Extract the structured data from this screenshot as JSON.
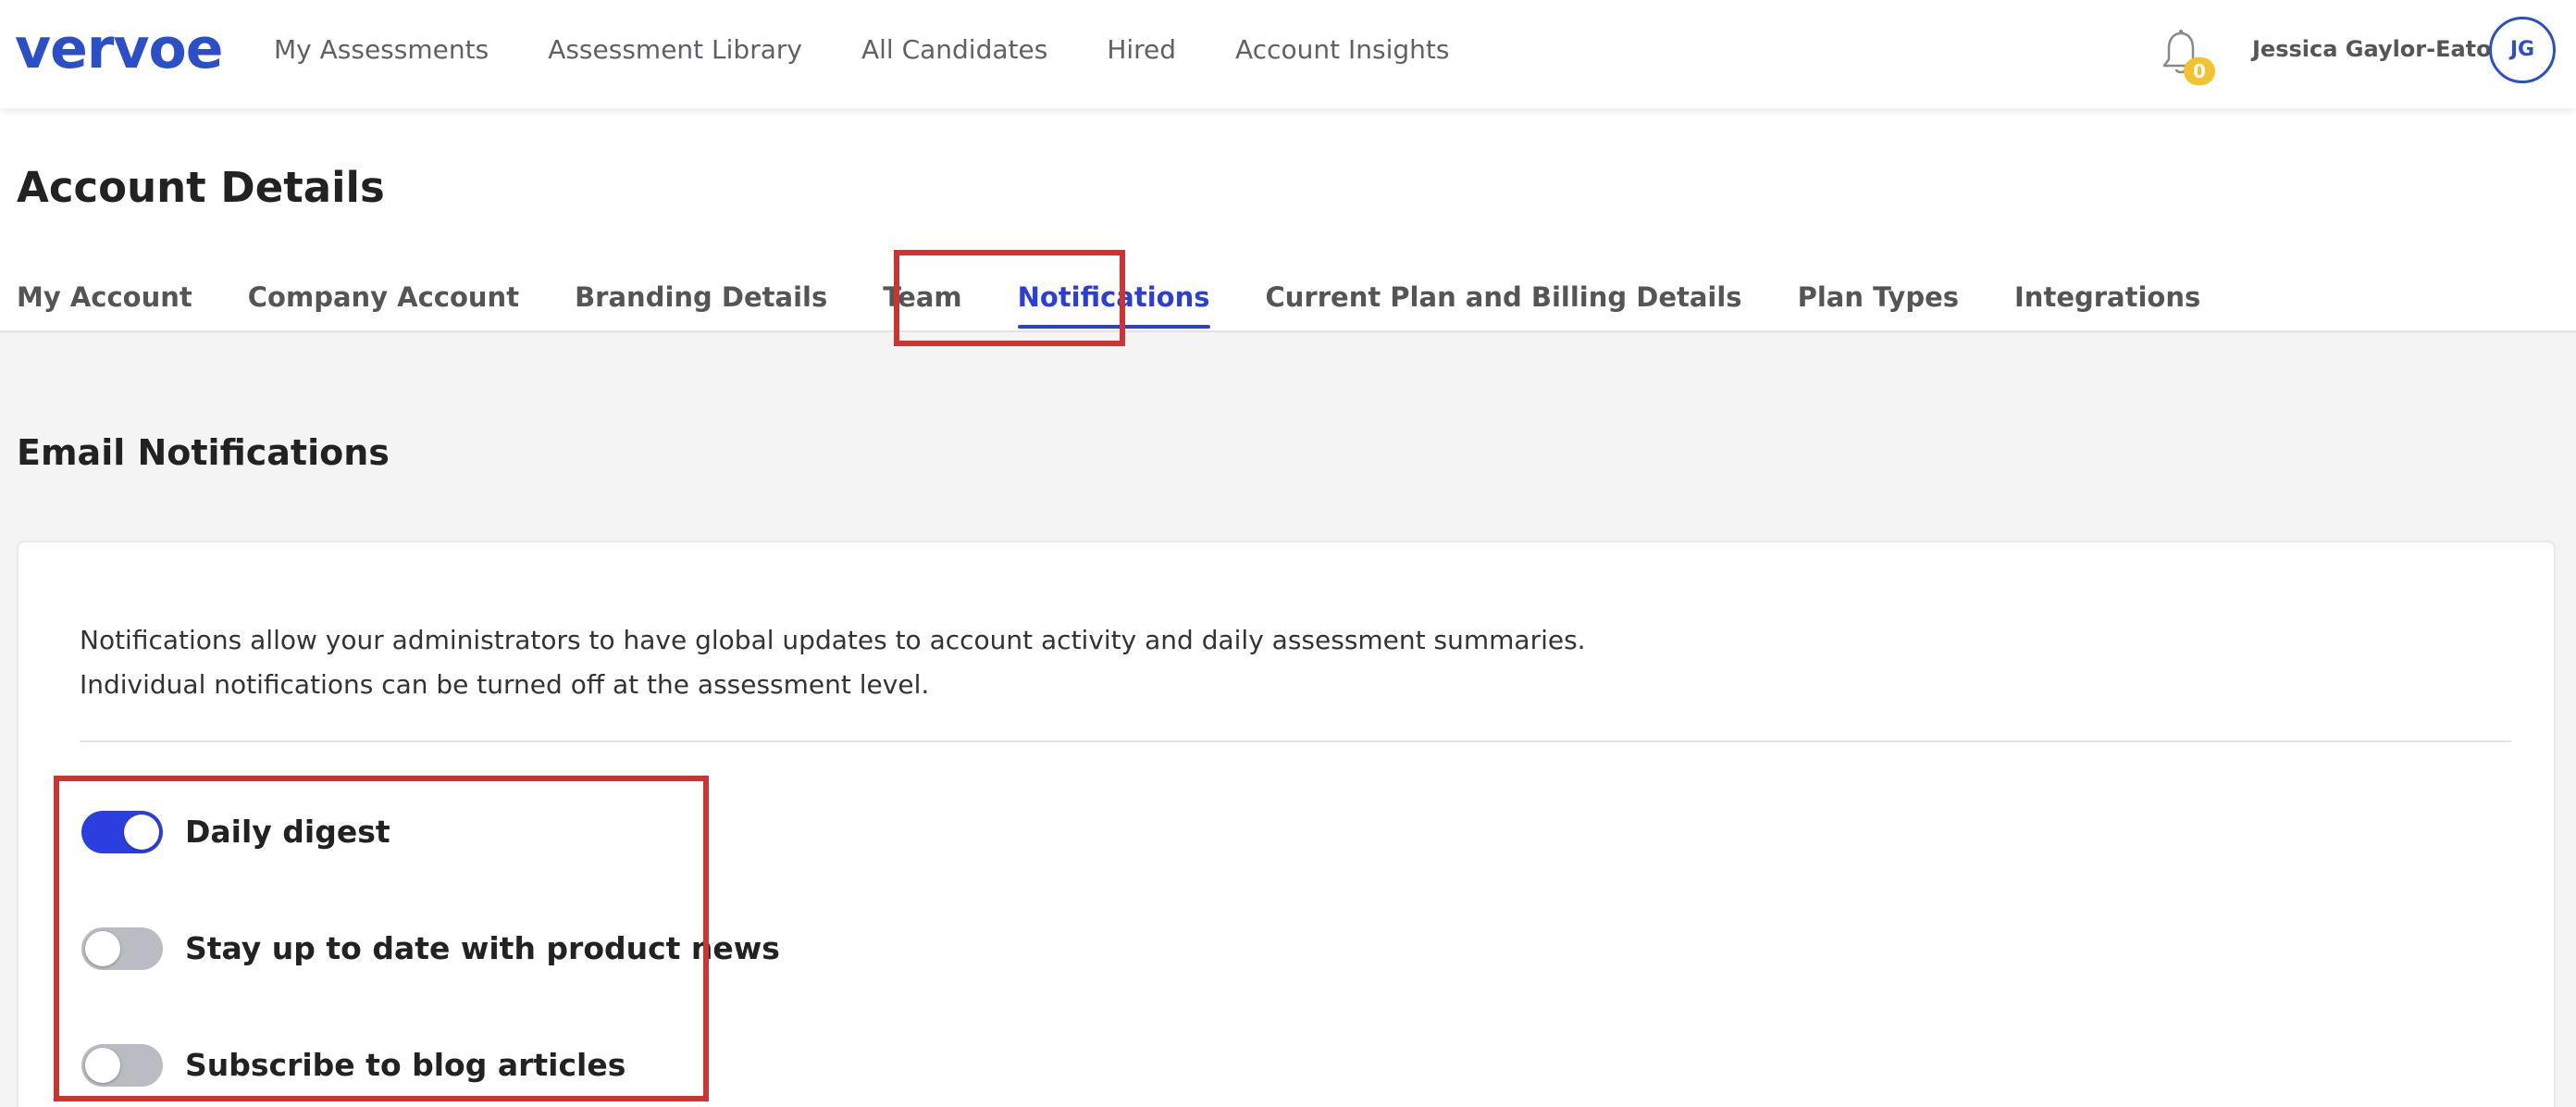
{
  "nav": {
    "logo": "vervoe",
    "links": [
      "My Assessments",
      "Assessment Library",
      "All Candidates",
      "Hired",
      "Account Insights"
    ],
    "notification_count": "0",
    "user_name": "Jessica Gaylor-Eaton",
    "avatar_initials": "JG"
  },
  "page": {
    "title": "Account Details",
    "tabs": [
      "My Account",
      "Company Account",
      "Branding Details",
      "Team",
      "Notifications",
      "Current Plan and Billing Details",
      "Plan Types",
      "Integrations"
    ],
    "active_tab": "Notifications"
  },
  "email_notifications": {
    "title": "Email Notifications",
    "description_line1": "Notifications allow your administrators to have global updates to account activity and daily assessment summaries.",
    "description_line2": "Individual notifications can be turned off at the assessment level.",
    "toggles": [
      {
        "label": "Daily digest",
        "on": true
      },
      {
        "label": "Stay up to date with product news",
        "on": false
      },
      {
        "label": "Subscribe to blog articles",
        "on": false
      }
    ]
  },
  "colors": {
    "brand": "#2b4fc8",
    "active_tab": "#2b3fd6",
    "toggle_on": "#2b3fe0",
    "toggle_off": "#b9bcc2",
    "badge": "#f2c230",
    "annotation": "#cc3333"
  }
}
